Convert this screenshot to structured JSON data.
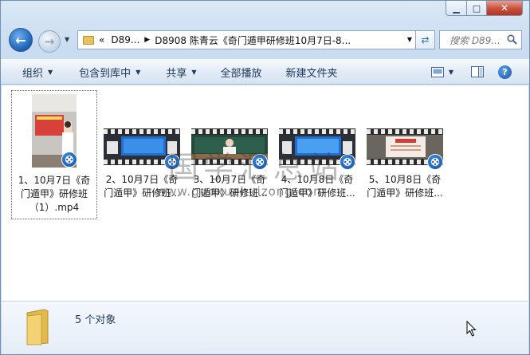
{
  "window": {
    "controls": {
      "minimize": "▁",
      "maximize": "□",
      "close": "✕"
    }
  },
  "address_bar": {
    "overflow_marker": "«",
    "crumbs": [
      "D89...",
      "D8908 陈青云《奇门遁甲研修班10月7日-8..."
    ]
  },
  "search": {
    "placeholder": "搜索 D89..."
  },
  "toolbar": {
    "organize": "组织",
    "include_in_library": "包含到库中",
    "share": "共享",
    "play_all": "全部播放",
    "new_folder": "新建文件夹"
  },
  "files": [
    {
      "name": "1、10月7日《奇门遁甲》研修班（1）.mp4",
      "selected": true
    },
    {
      "name": "2、10月7日《奇门遁甲》研修班...",
      "selected": false
    },
    {
      "name": "3、10月7日《奇门遁甲》研修班...",
      "selected": false
    },
    {
      "name": "4、10月8日《奇门遁甲》研修班...",
      "selected": false
    },
    {
      "name": "5、10月8日《奇门遁甲》研修班...",
      "selected": false
    }
  ],
  "watermark": {
    "text_cn": "国学汇总站",
    "url": "www.guoxuehuizong.com"
  },
  "status": {
    "item_count": "5 个对象"
  }
}
